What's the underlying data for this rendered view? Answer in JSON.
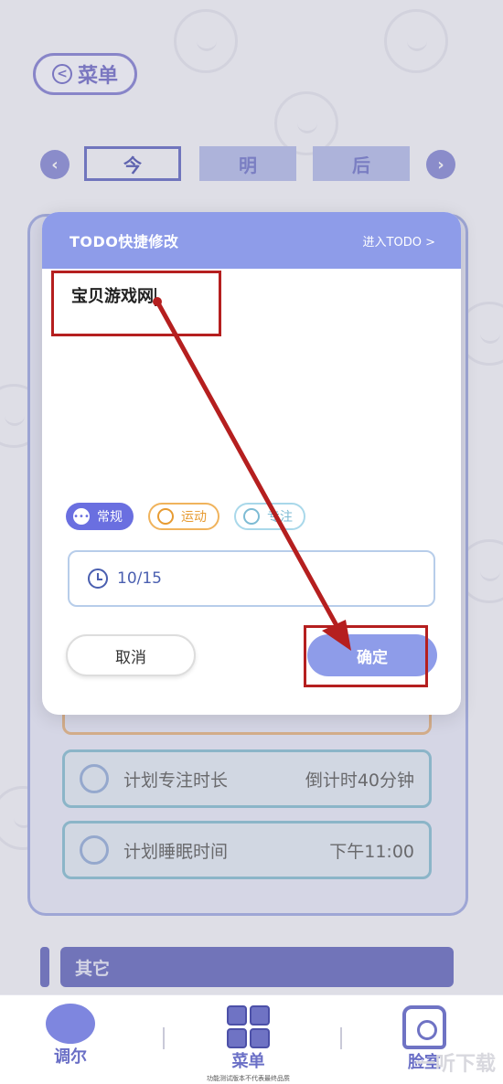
{
  "header": {
    "back_label": "菜单"
  },
  "day_tabs": {
    "today": "今",
    "tomorrow": "明",
    "after": "后"
  },
  "modal": {
    "title": "TODO快捷修改",
    "link": "进入TODO >",
    "todo_text": "宝贝游戏网",
    "tags": {
      "normal": "常规",
      "sport": "运动",
      "focus": "专注"
    },
    "date": "10/15",
    "cancel": "取消",
    "confirm": "确定"
  },
  "background_rows": {
    "focus_label": "计划专注时长",
    "focus_value": "倒计时40分钟",
    "sleep_label": "计划睡眠时间",
    "sleep_value": "下午11:00"
  },
  "other_section": "其它",
  "bottom_nav": {
    "left": "调尔",
    "center": "菜单",
    "center_note": "功能测试版本不代表最终品质",
    "right": "脸室"
  },
  "watermark": "一听下载",
  "colors": {
    "accent": "#8e9ce9",
    "annotation": "#b51f1f",
    "nav": "#6f73c4"
  }
}
